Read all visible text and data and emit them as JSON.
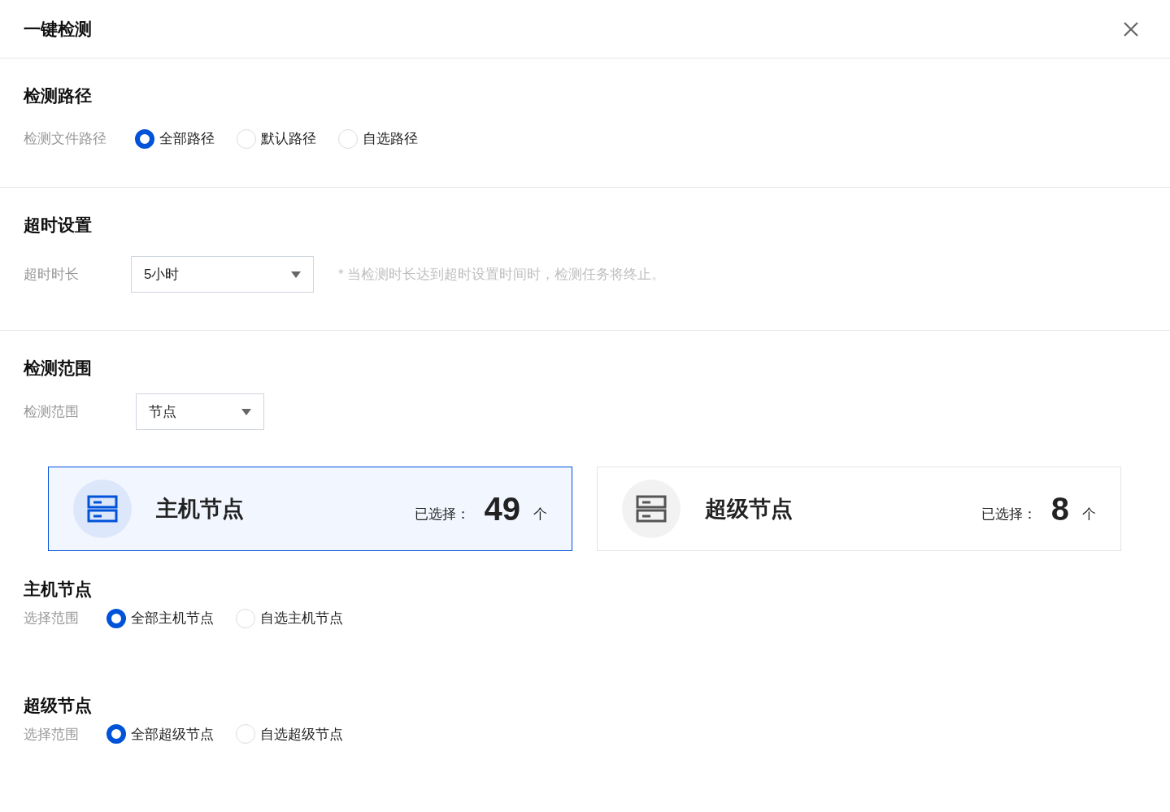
{
  "dialog": {
    "title": "一键检测"
  },
  "path_section": {
    "title": "检测路径",
    "label": "检测文件路径",
    "options": [
      {
        "label": "全部路径",
        "selected": true
      },
      {
        "label": "默认路径",
        "selected": false
      },
      {
        "label": "自选路径",
        "selected": false
      }
    ]
  },
  "timeout_section": {
    "title": "超时设置",
    "label": "超时时长",
    "select": {
      "value": "5小时"
    },
    "hint": "* 当检测时长达到超时设置时间时，检测任务将终止。"
  },
  "scope_section": {
    "title": "检测范围",
    "label": "检测范围",
    "select": {
      "value": "节点"
    },
    "cards": [
      {
        "name": "主机节点",
        "selected_label": "已选择：",
        "count": "49",
        "unit": "个",
        "selected": true
      },
      {
        "name": "超级节点",
        "selected_label": "已选择：",
        "count": "8",
        "unit": "个",
        "selected": false
      }
    ]
  },
  "node_groups": [
    {
      "title": "主机节点",
      "label": "选择范围",
      "options": [
        {
          "label": "全部主机节点",
          "selected": true
        },
        {
          "label": "自选主机节点",
          "selected": false
        }
      ]
    },
    {
      "title": "超级节点",
      "label": "选择范围",
      "options": [
        {
          "label": "全部超级节点",
          "selected": true
        },
        {
          "label": "自选超级节点",
          "selected": false
        }
      ]
    }
  ]
}
